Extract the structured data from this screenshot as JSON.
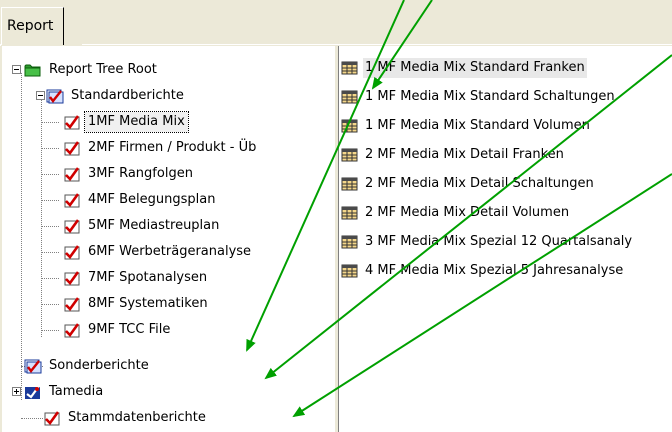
{
  "tabs": [
    {
      "label": "Report"
    }
  ],
  "tree": {
    "root": {
      "label": "Report Tree Root",
      "icon": "folder-icon",
      "expanded": true
    },
    "standard": {
      "label": "Standardberichte",
      "icon": "report-group-icon",
      "expanded": true,
      "children": [
        {
          "label": "1MF Media Mix",
          "selected": true
        },
        {
          "label": "2MF Firmen / Produkt - Üb"
        },
        {
          "label": "3MF Rangfolgen"
        },
        {
          "label": "4MF Belegungsplan"
        },
        {
          "label": "5MF Mediastreuplan"
        },
        {
          "label": "6MF Werbeträgeranalyse"
        },
        {
          "label": "7MF Spotanalysen"
        },
        {
          "label": "8MF Systematiken"
        },
        {
          "label": "9MF TCC File"
        }
      ]
    },
    "sonder": {
      "label": "Sonderberichte",
      "icon": "report-group-icon"
    },
    "tamedia": {
      "label": "Tamedia",
      "icon": "report-group-icon",
      "expanded": false
    },
    "stammdaten": {
      "label": "Stammdatenberichte",
      "icon": "report-icon"
    }
  },
  "list": {
    "items": [
      {
        "label": "1 MF Media Mix Standard Franken",
        "selected": true
      },
      {
        "label": "1 MF Media Mix Standard Schaltungen"
      },
      {
        "label": "1 MF Media Mix Standard Volumen"
      },
      {
        "label": "2 MF Media Mix Detail Franken"
      },
      {
        "label": "2 MF Media Mix Detail Schaltungen"
      },
      {
        "label": "2 MF Media Mix Detail Volumen"
      },
      {
        "label": "3 MF Media Mix Spezial 12 Quartalsanaly"
      },
      {
        "label": "4 MF Media Mix Spezial 5 Jahresanalyse"
      }
    ]
  },
  "colors": {
    "annotation_arrow": "#00a000",
    "check": "#d00000"
  }
}
